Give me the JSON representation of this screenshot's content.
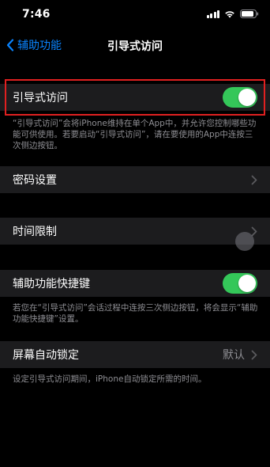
{
  "status_bar": {
    "time": "7:46"
  },
  "nav": {
    "back_label": "辅助功能",
    "title": "引导式访问"
  },
  "guided_access": {
    "label": "引导式访问",
    "enabled": true,
    "footnote": "“引导式访问”会将iPhone维持在单个App中，并允许您控制哪些功能可供使用。若要启动“引导式访问”，请在要使用的App中连按三次侧边按钮。"
  },
  "passcode_settings": {
    "label": "密码设置"
  },
  "time_limits": {
    "label": "时间限制"
  },
  "accessibility_shortcut": {
    "label": "辅助功能快捷键",
    "enabled": true,
    "footnote": "若您在“引导式访问”会话过程中连按三次侧边按钮，将会显示“辅助功能快捷键”设置。"
  },
  "auto_lock": {
    "label": "屏幕自动锁定",
    "value": "默认",
    "footnote": "设定引导式访问期间，iPhone自动锁定所需的时间。"
  },
  "colors": {
    "background": "#000000",
    "cell": "#1c1c1e",
    "accent": "#0a84ff",
    "toggle_on": "#34c759",
    "highlight": "#e02020",
    "secondary_text": "#8e8e93"
  }
}
